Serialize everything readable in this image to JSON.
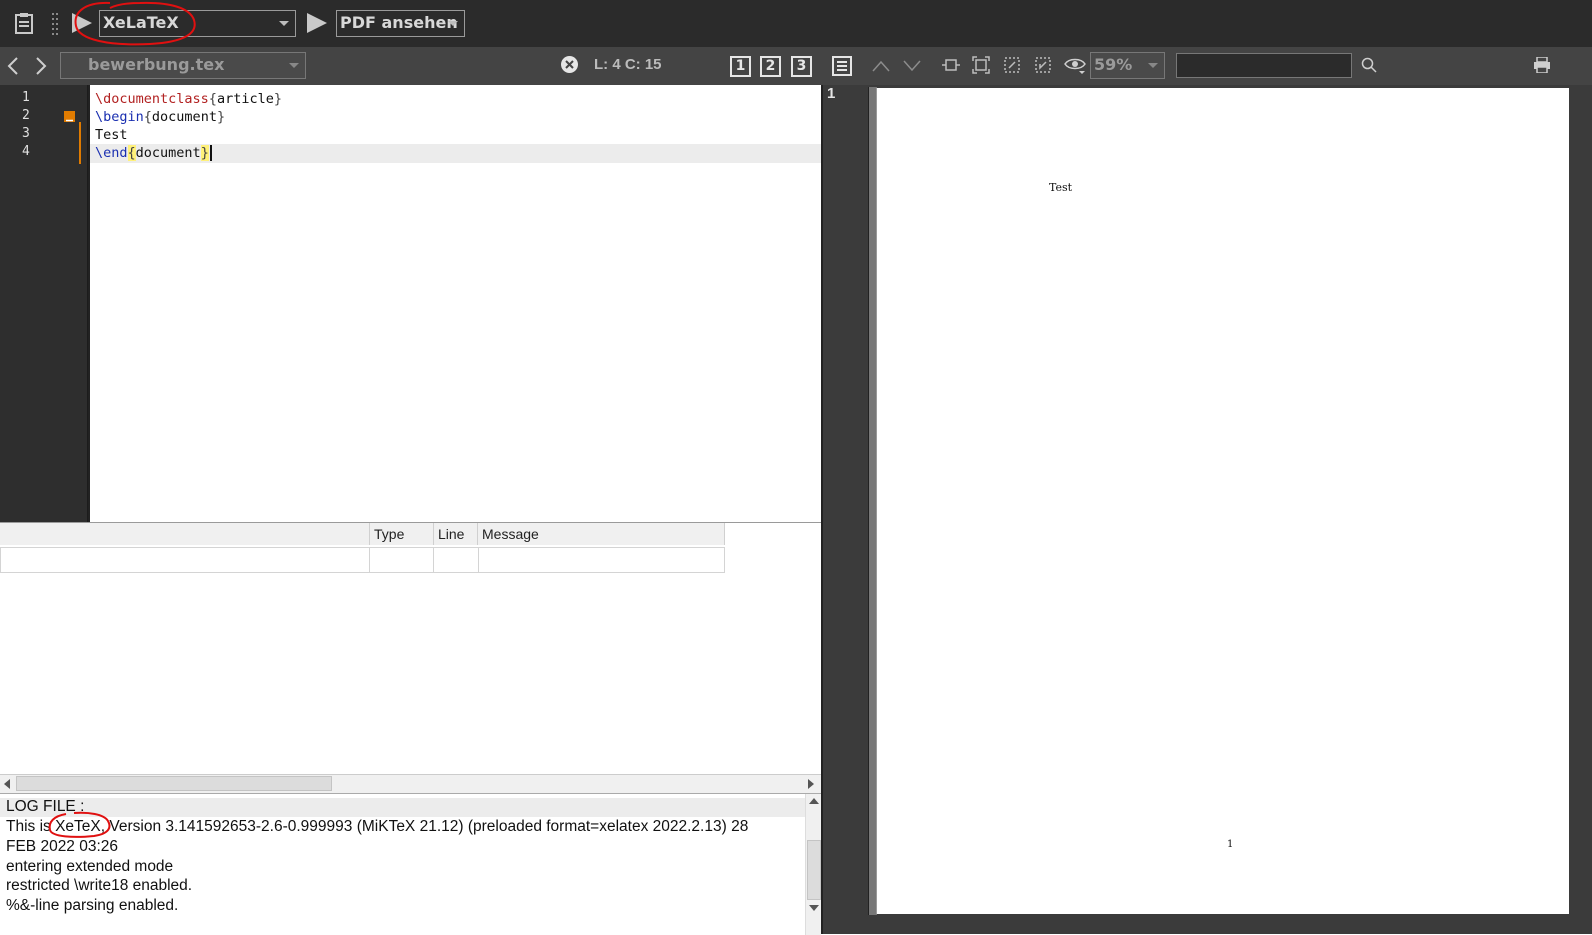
{
  "top_toolbar": {
    "compiler": "XeLaTeX",
    "viewer_action": "PDF ansehen"
  },
  "toolbar2": {
    "filename": "bewerbung.tex",
    "cursor_position": "L: 4 C: 15",
    "layout_buttons": [
      "1",
      "2",
      "3"
    ],
    "zoom": "59%",
    "search_value": ""
  },
  "editor": {
    "line_numbers": [
      "1",
      "2",
      "3",
      "4"
    ],
    "lines": {
      "l1_cmd": "\\documentclass",
      "l1_arg": "article",
      "l2_cmd": "\\begin",
      "l2_arg": "document",
      "l3_text": "Test",
      "l4_cmd": "\\end",
      "l4_arg": "document"
    }
  },
  "messages": {
    "columns": [
      "Type",
      "Line",
      "Message"
    ]
  },
  "log": {
    "lines": [
      "LOG FILE :",
      "This is XeTeX, Version 3.141592653-2.6-0.999993 (MiKTeX 21.12) (preloaded format=xelatex 2022.2.13) 28",
      "FEB 2022 03:26",
      "entering extended mode",
      "restricted \\write18 enabled.",
      "%&-line parsing enabled."
    ]
  },
  "pdf": {
    "page_indicator": "1",
    "page_text": "Test",
    "page_number": "1"
  },
  "colors": {
    "annotation_red": "#e01010",
    "dark_toolbar": "#2b2b2b",
    "secondary_toolbar": "#444444"
  }
}
